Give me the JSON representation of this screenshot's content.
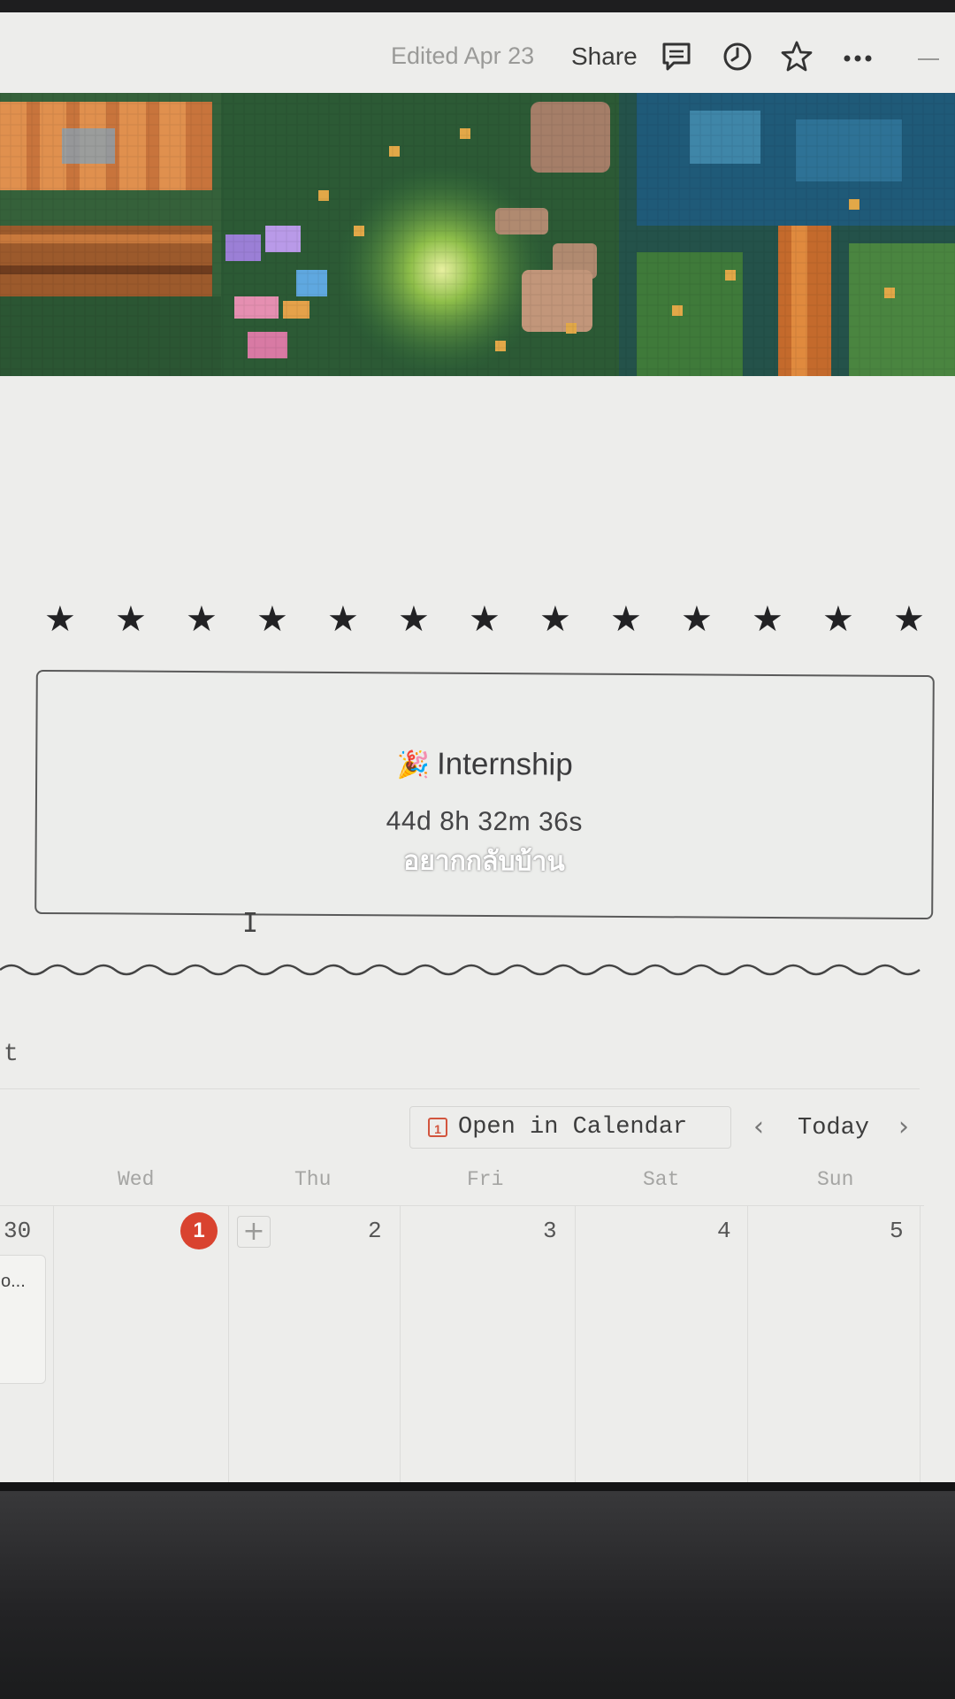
{
  "topbar": {
    "edited_label": "Edited Apr 23",
    "share_label": "Share",
    "icons": [
      "comment-icon",
      "history-icon",
      "star-icon",
      "more-icon",
      "collapse-icon"
    ]
  },
  "banner": {
    "description": "pixel-art-forest-banner"
  },
  "stars": {
    "glyph": "★",
    "count": 13
  },
  "countdown": {
    "emoji": "🎉",
    "title": "Internship",
    "timer": "44d 8h 32m 36s",
    "caption": "อยากกลับบ้าน"
  },
  "section": {
    "heading_fragment": "t"
  },
  "calendar": {
    "open_label": "Open in Calendar",
    "icon_glyph": "1",
    "today_label": "Today",
    "prev_glyph": "‹",
    "next_glyph": "›",
    "weekdays": [
      "Wed",
      "Thu",
      "Fri",
      "Sat",
      "Sun"
    ],
    "days": [
      "30",
      "1",
      "2",
      "3",
      "4",
      "5"
    ],
    "today_day": "1",
    "add_glyph": "+",
    "event_fragment": "o..."
  },
  "colors": {
    "accent_red": "#d9432f",
    "page_bg": "#ededeb",
    "text": "#3b3b3d"
  }
}
